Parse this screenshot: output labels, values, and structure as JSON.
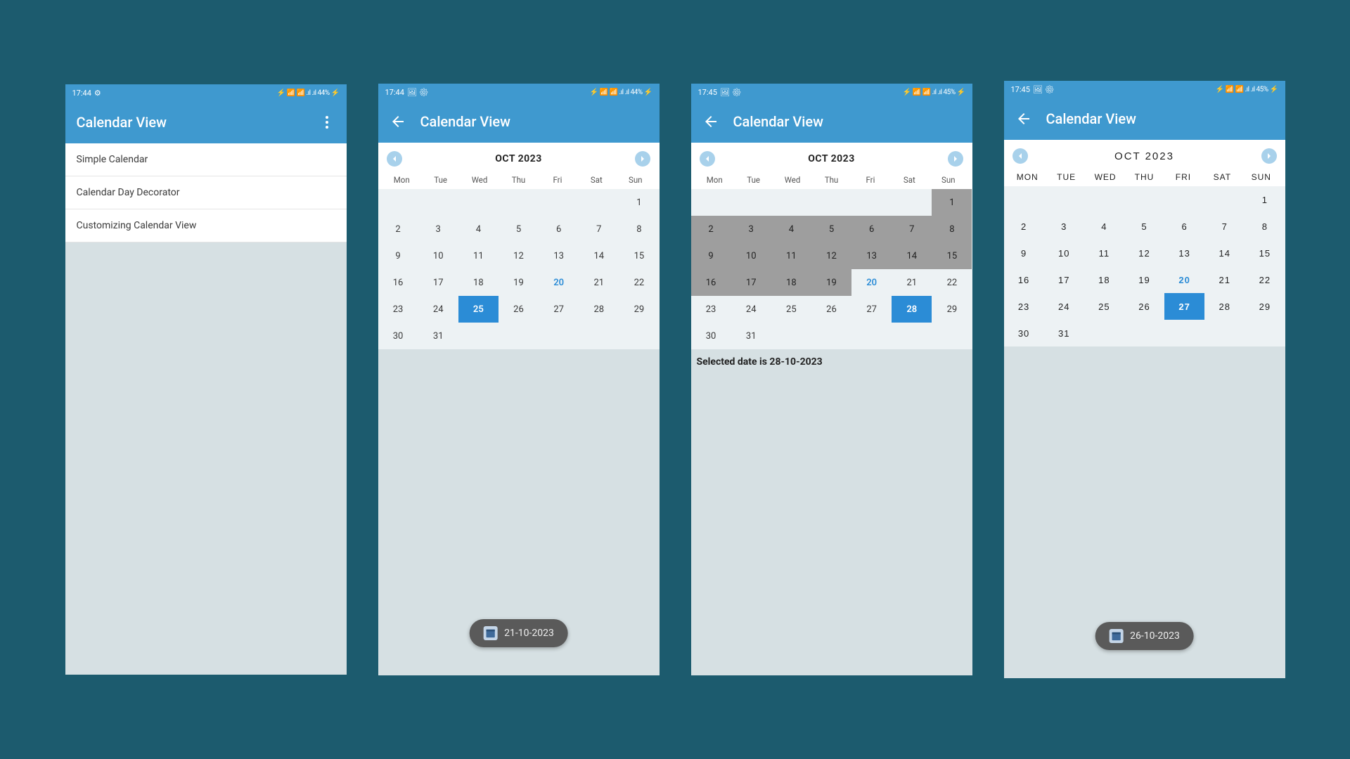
{
  "screens": [
    {
      "statusbar": {
        "time": "17:44",
        "icons_left": "⚙",
        "icons_right": "⚡ 📶 📶 .ıl .ıl 44% ⚡"
      },
      "appbar": {
        "title": "Calendar View",
        "has_back": false,
        "has_menu": true
      },
      "list_items": [
        "Simple Calendar",
        "Calendar Day Decorator",
        "Customizing Calendar View"
      ]
    },
    {
      "statusbar": {
        "time": "17:44",
        "icons_left": "🖼 ⚙",
        "icons_right": "⚡ 📶 📶 .ıl .ıl 44% ⚡"
      },
      "appbar": {
        "title": "Calendar View",
        "has_back": true,
        "has_menu": false
      },
      "calendar": {
        "month": "OCT 2023",
        "weekdays": [
          "Mon",
          "Tue",
          "Wed",
          "Thu",
          "Fri",
          "Sat",
          "Sun"
        ],
        "today": 20,
        "selected": 25,
        "highlighted": [],
        "style": "normal"
      },
      "fab": "21-10-2023"
    },
    {
      "statusbar": {
        "time": "17:45",
        "icons_left": "🖼 ⚙",
        "icons_right": "⚡ 📶 📶 .ıl .ıl 45% ⚡"
      },
      "appbar": {
        "title": "Calendar View",
        "has_back": true,
        "has_menu": false
      },
      "calendar": {
        "month": "OCT 2023",
        "weekdays": [
          "Mon",
          "Tue",
          "Wed",
          "Thu",
          "Fri",
          "Sat",
          "Sun"
        ],
        "today": 20,
        "selected": 28,
        "highlighted": [
          1,
          2,
          3,
          4,
          5,
          6,
          7,
          8,
          9,
          10,
          11,
          12,
          13,
          14,
          15,
          16,
          17,
          18,
          19
        ],
        "style": "normal"
      },
      "selected_text": "Selected date is 28-10-2023"
    },
    {
      "statusbar": {
        "time": "17:45",
        "icons_left": "🖼 ⚙",
        "icons_right": "⚡ 📶 📶 .ıl .ıl 45% ⚡"
      },
      "appbar": {
        "title": "Calendar View",
        "has_back": true,
        "has_menu": false
      },
      "calendar": {
        "month": "OCT 2023",
        "weekdays": [
          "Mon",
          "Tue",
          "Wed",
          "Thu",
          "Fri",
          "Sat",
          "Sun"
        ],
        "today": 20,
        "selected": 27,
        "highlighted": [],
        "style": "bangers"
      },
      "fab": "26-10-2023"
    }
  ],
  "october_layout": {
    "first_day_col": 6,
    "days_in_month": 31
  }
}
